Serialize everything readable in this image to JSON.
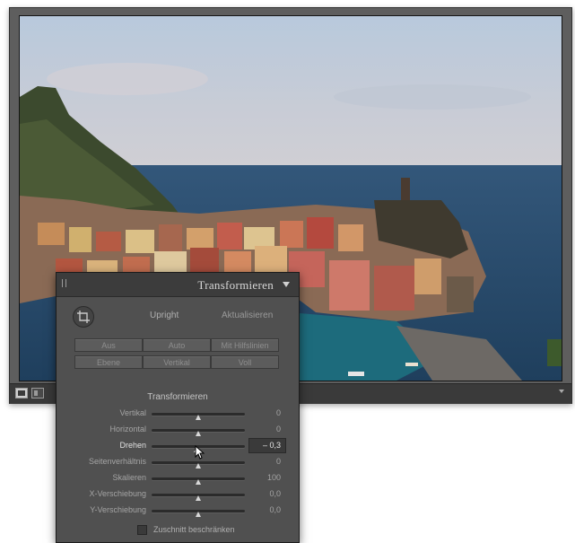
{
  "panel": {
    "title": "Transformieren",
    "upright_label": "Upright",
    "update_label": "Aktualisieren",
    "upright_buttons": [
      "Aus",
      "Auto",
      "Mit Hilfslinien",
      "Ebene",
      "Vertikal",
      "Voll"
    ],
    "section_title": "Transformieren",
    "sliders": [
      {
        "label": "Vertikal",
        "value": "0",
        "level": 0.5
      },
      {
        "label": "Horizontal",
        "value": "0",
        "level": 0.5
      },
      {
        "label": "Drehen",
        "value": "– 0,3",
        "level": 0.485
      },
      {
        "label": "Seitenverhältnis",
        "value": "0",
        "level": 0.5
      },
      {
        "label": "Skalieren",
        "value": "100",
        "level": 0.5
      },
      {
        "label": "X-Verschiebung",
        "value": "0,0",
        "level": 0.5
      },
      {
        "label": "Y-Verschiebung",
        "value": "0,0",
        "level": 0.5
      }
    ],
    "constrain_crop_label": "Zuschnitt beschränken"
  },
  "icons": {
    "crop": "crop-icon",
    "collapse": "triangle-down-icon",
    "loupe_view": "single-view-icon",
    "grid_view": "compare-view-icon"
  },
  "colors": {
    "panel_bg": "#505050",
    "window_bg": "#5e5e5e"
  }
}
